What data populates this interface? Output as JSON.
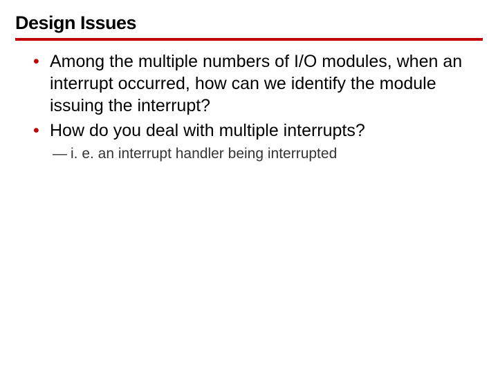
{
  "title": "Design Issues",
  "bullets": {
    "item1": "Among the multiple numbers of I/O modules, when an interrupt occurred, how can we identify the module issuing the interrupt?",
    "item2": "How do you deal with multiple interrupts?",
    "sub2a": "i. e. an interrupt handler being interrupted"
  }
}
